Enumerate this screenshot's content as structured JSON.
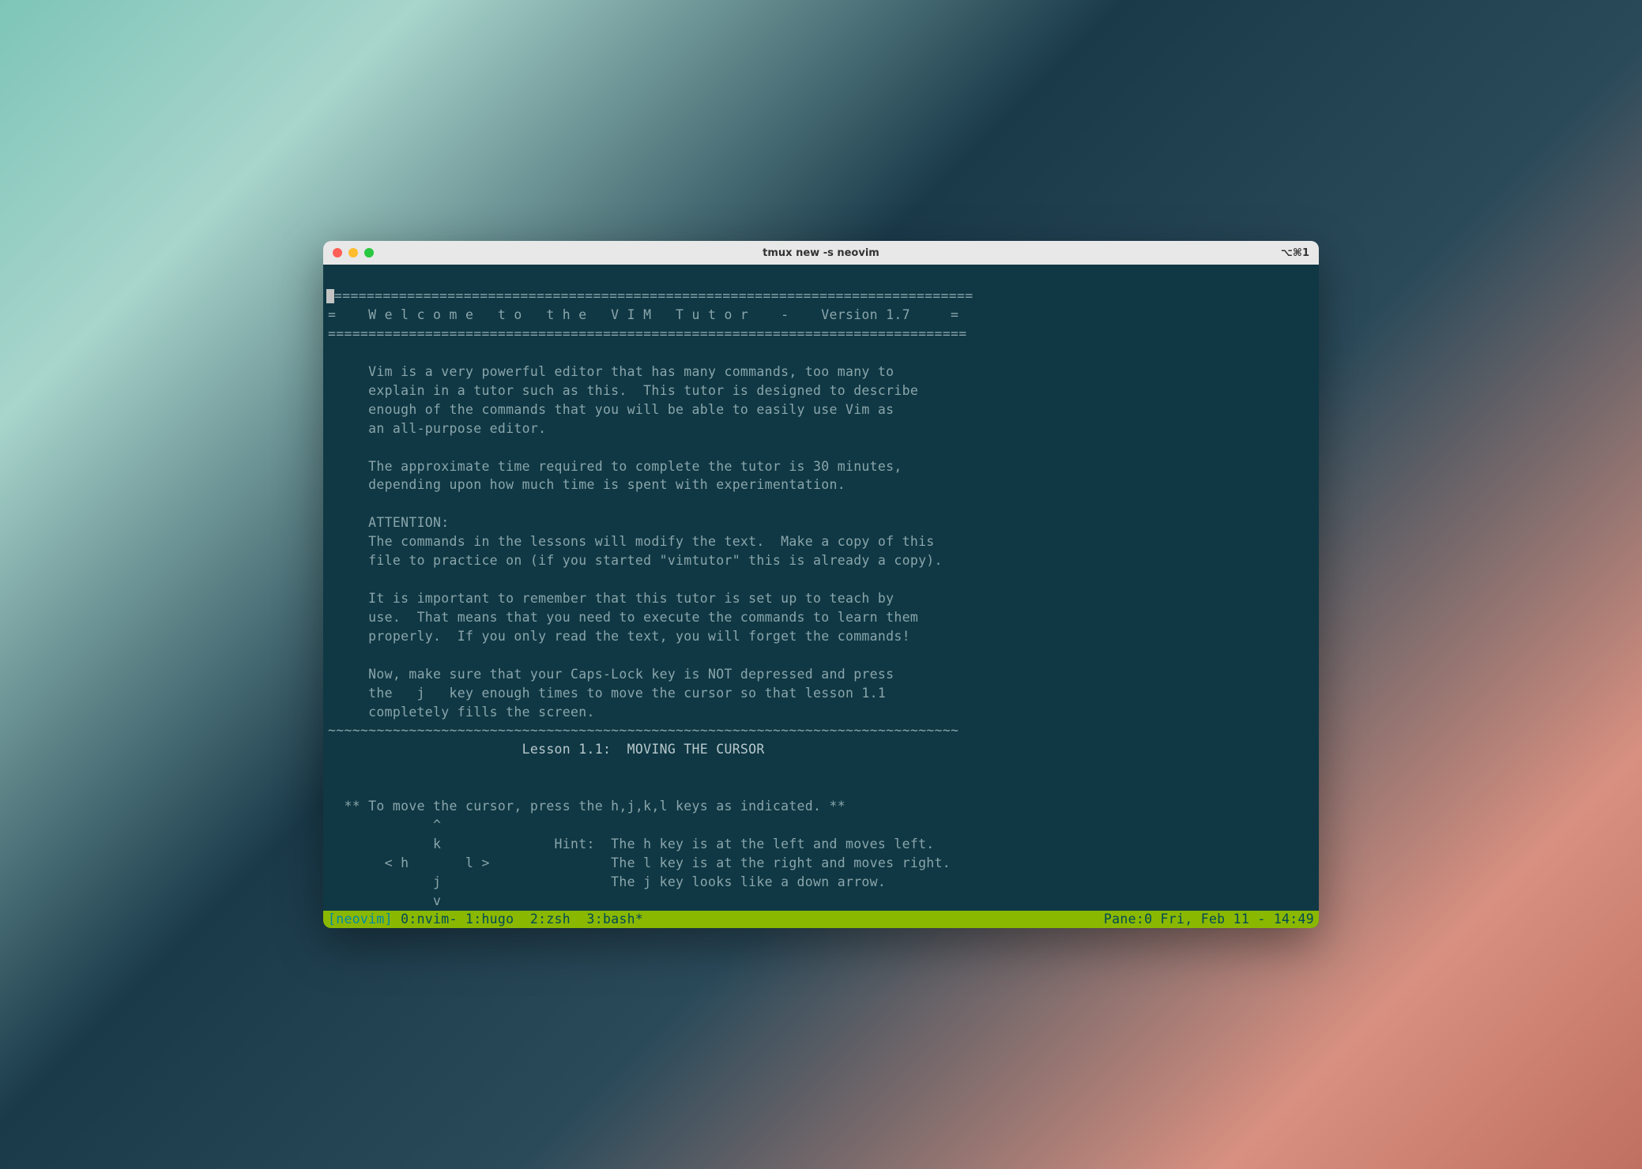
{
  "titlebar": {
    "title": "tmux new -s neovim",
    "shortcut": "⌥⌘1"
  },
  "content": {
    "border_top": "===============================================================================",
    "header_line": "=    W e l c o m e   t o   t h e   V I M   T u t o r    -    Version 1.7     =",
    "border_bot": "===============================================================================",
    "p1_l1": "     Vim is a very powerful editor that has many commands, too many to",
    "p1_l2": "     explain in a tutor such as this.  This tutor is designed to describe",
    "p1_l3": "     enough of the commands that you will be able to easily use Vim as",
    "p1_l4": "     an all-purpose editor.",
    "p2_l1": "     The approximate time required to complete the tutor is 30 minutes,",
    "p2_l2": "     depending upon how much time is spent with experimentation.",
    "p3_l1": "     ATTENTION:",
    "p3_l2": "     The commands in the lessons will modify the text.  Make a copy of this",
    "p3_l3": "     file to practice on (if you started \"vimtutor\" this is already a copy).",
    "p4_l1": "     It is important to remember that this tutor is set up to teach by",
    "p4_l2": "     use.  That means that you need to execute the commands to learn them",
    "p4_l3": "     properly.  If you only read the text, you will forget the commands!",
    "p5_l1": "     Now, make sure that your Caps-Lock key is NOT depressed and press",
    "p5_l2": "     the   j   key enough times to move the cursor so that lesson 1.1",
    "p5_l3": "     completely fills the screen.",
    "tildes": "~~~~~~~~~~~~~~~~~~~~~~~~~~~~~~~~~~~~~~~~~~~~~~~~~~~~~~~~~~~~~~~~~~~~~~~~~~~~~~",
    "lesson_title": "                        Lesson 1.1:  MOVING THE CURSOR",
    "hint_title": "  ** To move the cursor, press the h,j,k,l keys as indicated. **",
    "diag_l1": "             ^",
    "diag_l2": "             k              Hint:  The h key is at the left and moves left.",
    "diag_l3": "       < h       l >               The l key is at the right and moves right.",
    "diag_l4": "             j                     The j key looks like a down arrow.",
    "diag_l5": "             v"
  },
  "status": {
    "session": "[neovim] ",
    "win0": "0:nvim- ",
    "win1": "1:hugo  ",
    "win2": "2:zsh  ",
    "win3": "3:bash*",
    "right": "Pane:0 Fri, Feb 11 - 14:49"
  }
}
